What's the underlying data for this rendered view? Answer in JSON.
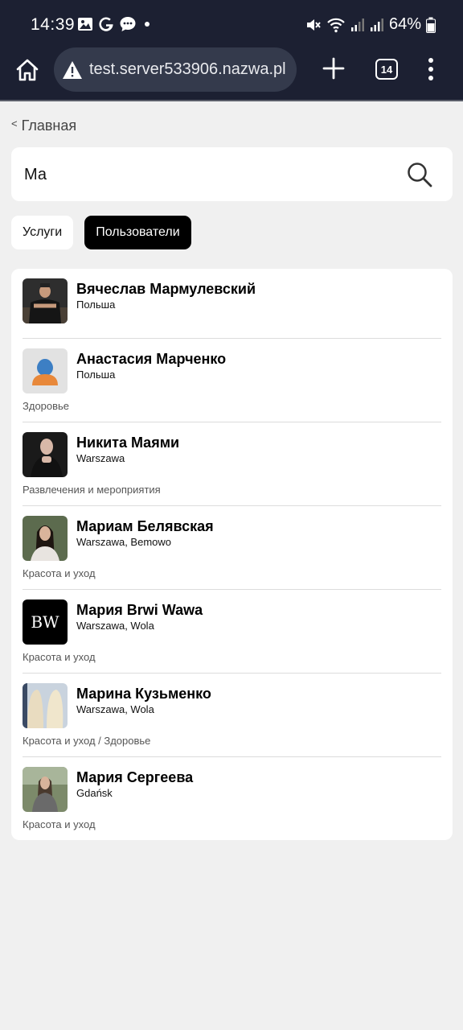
{
  "status_bar": {
    "time": "14:39",
    "notification_icons": [
      "image-icon",
      "google-icon",
      "chat-icon",
      "dot-icon"
    ],
    "system_icons": [
      "mute-icon",
      "wifi-icon",
      "signal-icon",
      "signal-icon",
      "battery-icon"
    ],
    "battery": "64%"
  },
  "browser": {
    "url": "test.server533906.nazwa.pl",
    "tab_count": "14"
  },
  "page": {
    "back_label": "Главная",
    "search": {
      "value": "Ма",
      "placeholder": ""
    },
    "tabs": [
      {
        "label": "Услуги",
        "active": false
      },
      {
        "label": "Пользователи",
        "active": true
      }
    ],
    "results": [
      {
        "name": "Вячеслав Мармулевский",
        "location": "Польша",
        "category": ""
      },
      {
        "name": "Анастасия Марченко",
        "location": "Польша",
        "category": "Здоровье"
      },
      {
        "name": "Никита Маями",
        "location": "Warszawa",
        "category": "Развлечения и мероприятия"
      },
      {
        "name": "Мариам Белявская",
        "location": "Warszawa, Bemowo",
        "category": "Красота и уход"
      },
      {
        "name": "Мария Brwi Wawa",
        "location": "Warszawa, Wola",
        "category": "Красота и уход",
        "avatar_logo": "BW"
      },
      {
        "name": "Марина Кузьменко",
        "location": "Warszawa, Wola",
        "category": "Красота и уход / Здоровье"
      },
      {
        "name": "Мария Сергеева",
        "location": "Gdańsk",
        "category": "Красота и уход"
      }
    ]
  },
  "colors": {
    "chrome_bg": "#1c2032",
    "url_pill": "#343a4c",
    "page_bg": "#f0f0f0",
    "active_tab": "#000000",
    "placeholder_avatar_bg": "#e2e2e2",
    "placeholder_avatar_fg": "#e8883a",
    "placeholder_avatar_body": "#3d7fc4"
  }
}
